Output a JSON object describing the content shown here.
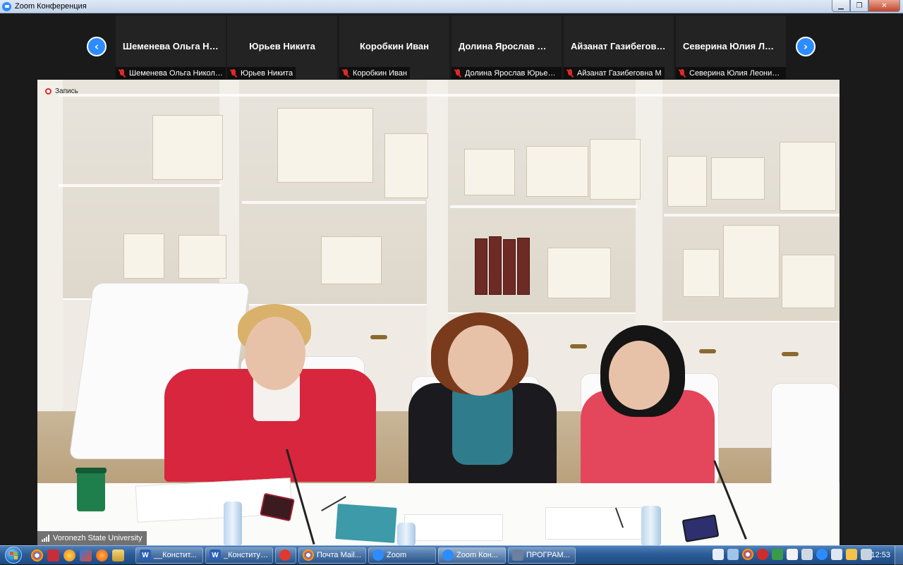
{
  "window": {
    "title": "Zoom Конференция"
  },
  "strip": {
    "participants": [
      {
        "name": "Шеменева  Ольга Николаевна",
        "label": "Шеменева Ольга Николаевна"
      },
      {
        "name": "Юрьев Никита",
        "label": "Юрьев Никита"
      },
      {
        "name": "Коробкин Иван",
        "label": "Коробкин Иван"
      },
      {
        "name": "Долина  Ярослав Юрьевич",
        "label": "Долина Ярослав Юрьевич"
      },
      {
        "name": "Айзанат  Газибеговна М",
        "label": "Айзанат Газибеговна М"
      },
      {
        "name": "Северина  Юлия Леонидовна",
        "label": "Северина Юлия Леонидовна"
      }
    ]
  },
  "main": {
    "recording_label": "Запись",
    "speaker_name": "Voronezh State University"
  },
  "taskbar": {
    "tasks": [
      {
        "label": "__Констит...",
        "icon": "W",
        "color": "#2b5fb4"
      },
      {
        "label": "_Конституц...",
        "icon": "W",
        "color": "#2b5fb4"
      },
      {
        "label": "",
        "icon": "",
        "color": "#e03a2f"
      },
      {
        "label": "Почта Mail...",
        "icon": "",
        "color": "#1a73e8"
      },
      {
        "label": "Zoom",
        "icon": "",
        "color": "#2d8cff"
      },
      {
        "label": "Zoom Кон...",
        "icon": "",
        "color": "#2d8cff"
      },
      {
        "label": "ПРОГРАМ...",
        "icon": "",
        "color": "#6b7fa0"
      }
    ],
    "clock": "12:53"
  },
  "colors": {
    "zoom_blue": "#2d8cff",
    "mute_red": "#e02828"
  }
}
